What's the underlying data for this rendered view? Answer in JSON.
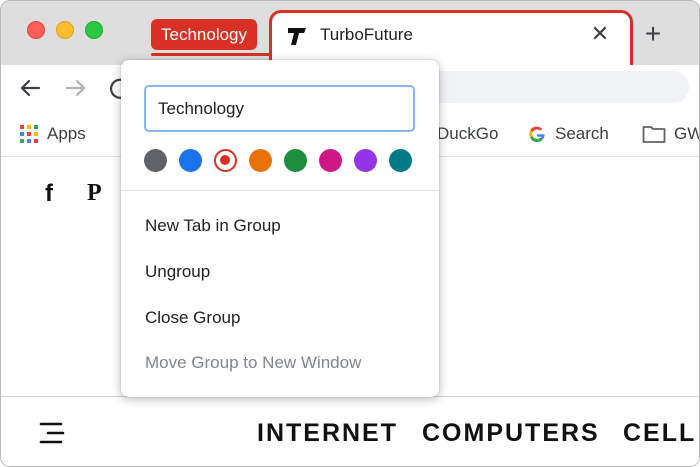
{
  "colors": {
    "group_red": "#d93025",
    "tabstrip_bg": "#dedede",
    "focus_blue": "#8ab4f8"
  },
  "tabstrip": {
    "group_label": "Technology",
    "active_tab": {
      "title": "TurboFuture",
      "favicon": "turbofuture-logo-icon",
      "close_icon": "close-icon"
    },
    "new_tab_icon": "plus-icon"
  },
  "toolbar": {
    "back_icon": "arrow-left-icon",
    "forward_icon": "arrow-right-icon"
  },
  "bookmarks": [
    {
      "label": "Apps",
      "icon": "apps-grid-icon"
    },
    {
      "label": "DuckGo",
      "icon": ""
    },
    {
      "label": "Search",
      "icon": "google-icon"
    },
    {
      "label": "GW",
      "icon": "folder-icon"
    }
  ],
  "group_editor": {
    "name_value": "Technology",
    "colors": [
      {
        "name": "grey",
        "hex": "#5f6368",
        "selected": false
      },
      {
        "name": "blue",
        "hex": "#1a73e8",
        "selected": false
      },
      {
        "name": "red",
        "hex": "#d93025",
        "selected": true
      },
      {
        "name": "orange",
        "hex": "#e8710a",
        "selected": false
      },
      {
        "name": "green",
        "hex": "#1e8e3e",
        "selected": false
      },
      {
        "name": "pink",
        "hex": "#d01884",
        "selected": false
      },
      {
        "name": "purple",
        "hex": "#9334e6",
        "selected": false
      },
      {
        "name": "cyan",
        "hex": "#007b83",
        "selected": false
      }
    ],
    "menu": [
      {
        "label": "New Tab in Group",
        "enabled": true
      },
      {
        "label": "Ungroup",
        "enabled": true
      },
      {
        "label": "Close Group",
        "enabled": true
      },
      {
        "label": "Move Group to New Window",
        "enabled": false
      }
    ]
  },
  "page": {
    "social_icons": [
      "facebook-icon",
      "pinterest-icon"
    ],
    "facebook_glyph": "f",
    "pinterest_glyph": "P",
    "nav_links": [
      "INTERNET",
      "COMPUTERS",
      "CELL"
    ]
  }
}
